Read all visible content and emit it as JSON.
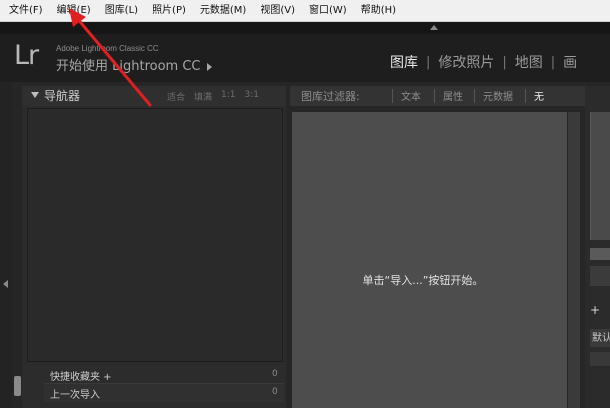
{
  "menubar": {
    "items": [
      "文件(F)",
      "编辑(E)",
      "图库(L)",
      "照片(P)",
      "元数据(M)",
      "视图(V)",
      "窗口(W)",
      "帮助(H)"
    ]
  },
  "identity": {
    "logo": "Lr",
    "adobe_text": "Adobe Lightroom Classic CC",
    "start_text": "开始使用 Lightroom CC"
  },
  "modules": {
    "items": [
      "图库",
      "修改照片",
      "地图",
      "画"
    ],
    "active": "图库"
  },
  "navigator": {
    "title": "导航器",
    "zoom_options": [
      "适合",
      "填满",
      "1:1",
      "3:1"
    ]
  },
  "collections": {
    "rows": [
      {
        "label": "快捷收藏夹 +",
        "count": "0"
      },
      {
        "label": "上一次导入",
        "count": "0"
      }
    ]
  },
  "filter_bar": {
    "label": "图库过滤器:",
    "tabs": [
      "文本",
      "属性",
      "元数据",
      "无"
    ],
    "active": "无"
  },
  "grid": {
    "empty_message": "单击“导入...”按钮开始。"
  },
  "right_panel": {
    "plus": "+",
    "default_label": "默认"
  },
  "colors": {
    "annotation_arrow": "#e02020",
    "grid_bg": "#4d4d4d",
    "menubar_bg": "#f0f0f0"
  }
}
